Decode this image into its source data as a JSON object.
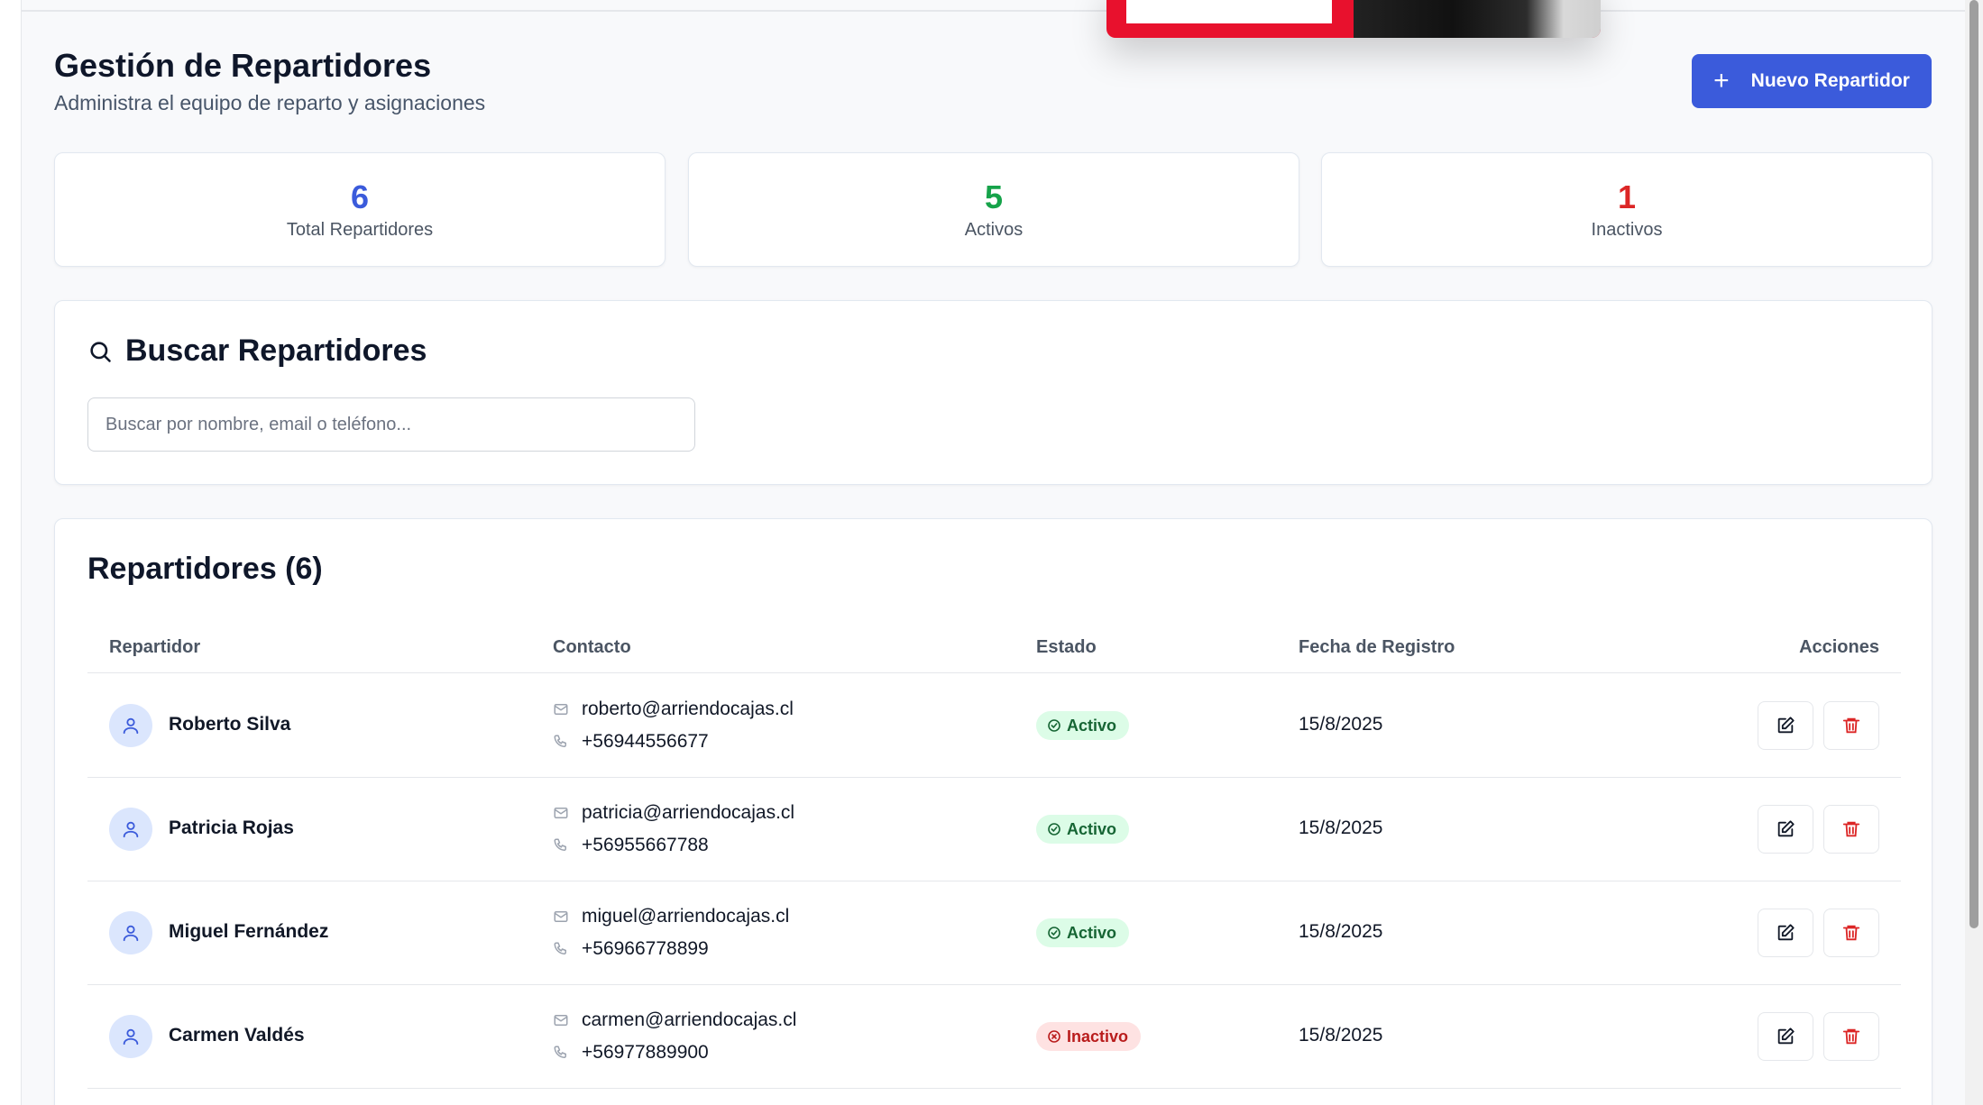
{
  "header": {
    "title": "Gestión de Repartidores",
    "subtitle": "Administra el equipo de reparto y asignaciones",
    "new_button_label": "Nuevo Repartidor"
  },
  "stats": [
    {
      "value": "6",
      "label": "Total Repartidores",
      "color": "#3b5bdb"
    },
    {
      "value": "5",
      "label": "Activos",
      "color": "#16a34a"
    },
    {
      "value": "1",
      "label": "Inactivos",
      "color": "#dc2626"
    }
  ],
  "search": {
    "title": "Buscar Repartidores",
    "placeholder": "Buscar por nombre, email o teléfono...",
    "value": ""
  },
  "list": {
    "title": "Repartidores (6)",
    "columns": [
      "Repartidor",
      "Contacto",
      "Estado",
      "Fecha de Registro",
      "Acciones"
    ],
    "rows": [
      {
        "name": "Roberto Silva",
        "email": "roberto@arriendocajas.cl",
        "phone": "+56944556677",
        "status": "Activo",
        "status_type": "active",
        "date": "15/8/2025"
      },
      {
        "name": "Patricia Rojas",
        "email": "patricia@arriendocajas.cl",
        "phone": "+56955667788",
        "status": "Activo",
        "status_type": "active",
        "date": "15/8/2025"
      },
      {
        "name": "Miguel Fernández",
        "email": "miguel@arriendocajas.cl",
        "phone": "+56966778899",
        "status": "Activo",
        "status_type": "active",
        "date": "15/8/2025"
      },
      {
        "name": "Carmen Valdés",
        "email": "carmen@arriendocajas.cl",
        "phone": "+56977889900",
        "status": "Inactivo",
        "status_type": "inactive",
        "date": "15/8/2025"
      }
    ]
  },
  "colors": {
    "accent": "#3b5bdb",
    "active": "#16a34a",
    "inactive": "#dc2626",
    "delete": "#dc2626"
  },
  "icons": {
    "new_button": "plus-icon",
    "search": "search-icon",
    "avatar": "user-icon",
    "email": "mail-icon",
    "phone": "phone-icon",
    "active": "check-circle-icon",
    "inactive": "x-circle-icon",
    "edit": "edit-icon",
    "delete": "trash-icon"
  }
}
